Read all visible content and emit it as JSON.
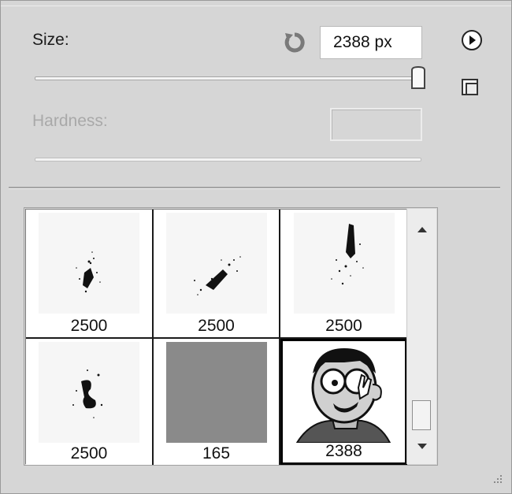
{
  "size": {
    "label": "Size:",
    "value": "2388 px",
    "slider_fraction": 0.97
  },
  "hardness": {
    "label": "Hardness:",
    "value": ""
  },
  "icons": {
    "reset": "reset-arrow-icon",
    "menu": "panel-menu-icon",
    "new_preset": "new-preset-icon",
    "scroll_up": "triangle-up-icon",
    "scroll_down": "triangle-down-icon",
    "grip": "resize-grip-icon"
  },
  "brushes": [
    {
      "size": "2500",
      "style": "splatter-small"
    },
    {
      "size": "2500",
      "style": "splatter-diagonal"
    },
    {
      "size": "2500",
      "style": "splatter-vertical"
    },
    {
      "size": "2500",
      "style": "splatter-swirl"
    },
    {
      "size": "165",
      "style": "grey-square"
    },
    {
      "size": "2388",
      "style": "cartoon-face",
      "selected": true
    }
  ],
  "colors": {
    "panel_bg": "#d6d6d6",
    "tile_border": "#1a1a1a",
    "disabled_text": "#a9a9a9"
  }
}
